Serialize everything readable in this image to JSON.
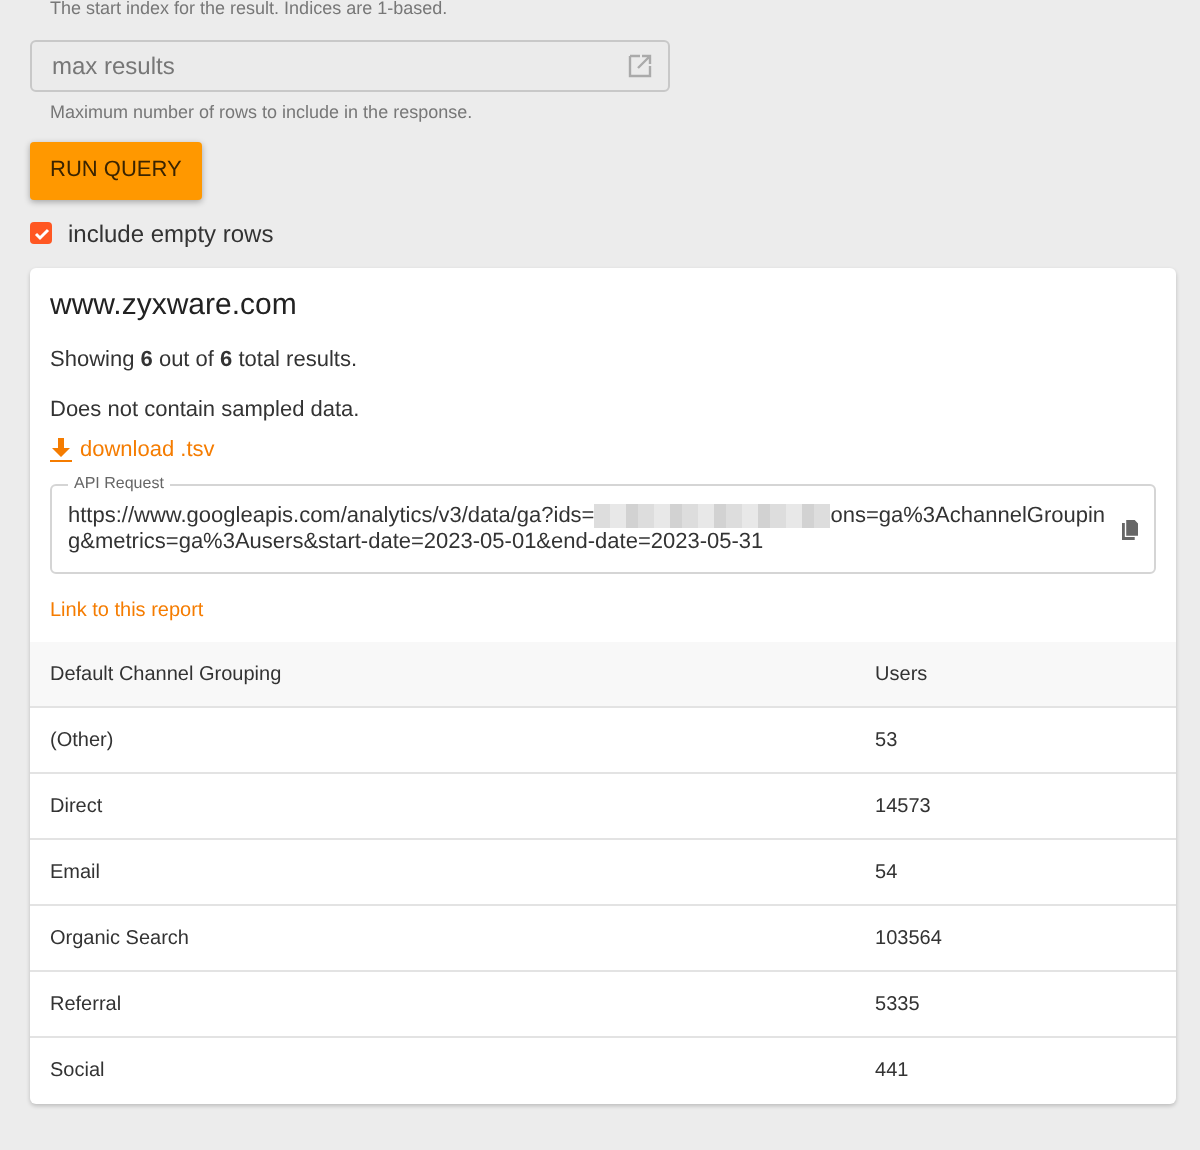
{
  "start_index_help": "The start index for the result. Indices are 1-based.",
  "max_results": {
    "placeholder": "max results",
    "help": "Maximum number of rows to include in the response."
  },
  "run_button": "RUN QUERY",
  "include_empty_rows": {
    "label": "include empty rows",
    "checked": true
  },
  "report": {
    "title": "www.zyxware.com",
    "summary": "Showing **6** out of **6** total results.",
    "sampling": "Does not contain sampled data.",
    "download": "download .tsv",
    "api_request": {
      "legend": "API Request",
      "url_start": "https://www.googleapis.com/analytics/v3/data/ga?ids=",
      "url_line_1_end": "ons=ga%3AchannelGroupin",
      "url_line_2": "g&metrics=ga%3Ausers&start-date=2023-05-01&end-date=2023-05-31"
    },
    "link": "Link to this report",
    "table": {
      "columns": [
        "Default Channel Grouping",
        "Users"
      ],
      "rows": [
        [
          "(Other)",
          "53"
        ],
        [
          "Direct",
          "14573"
        ],
        [
          "Email",
          "54"
        ],
        [
          "Organic Search",
          "103564"
        ],
        [
          "Referral",
          "5335"
        ],
        [
          "Social",
          "441"
        ]
      ]
    }
  }
}
